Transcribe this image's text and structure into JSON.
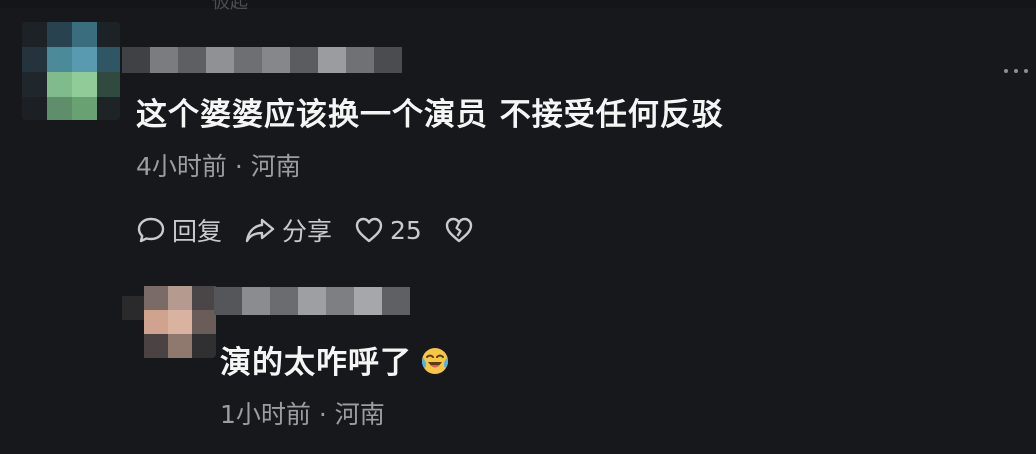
{
  "top_hint": "仮起",
  "comments": [
    {
      "text": "这个婆婆应该换一个演员  不接受任何反驳",
      "meta": "4小时前 · 河南",
      "actions": {
        "reply_label": "回复",
        "share_label": "分享",
        "like_count": "25"
      },
      "icons": [
        "comment-icon",
        "share-arrow-icon",
        "heart-icon",
        "broken-heart-icon"
      ]
    },
    {
      "text": "演的太咋呼了",
      "emoji": "crying-laughing-face-icon",
      "meta": "1小时前 · 河南"
    }
  ],
  "colors": {
    "background": "#17181c",
    "text_primary": "#f5f5f5",
    "text_secondary": "#9b9da2",
    "icon": "#c9cacf"
  }
}
